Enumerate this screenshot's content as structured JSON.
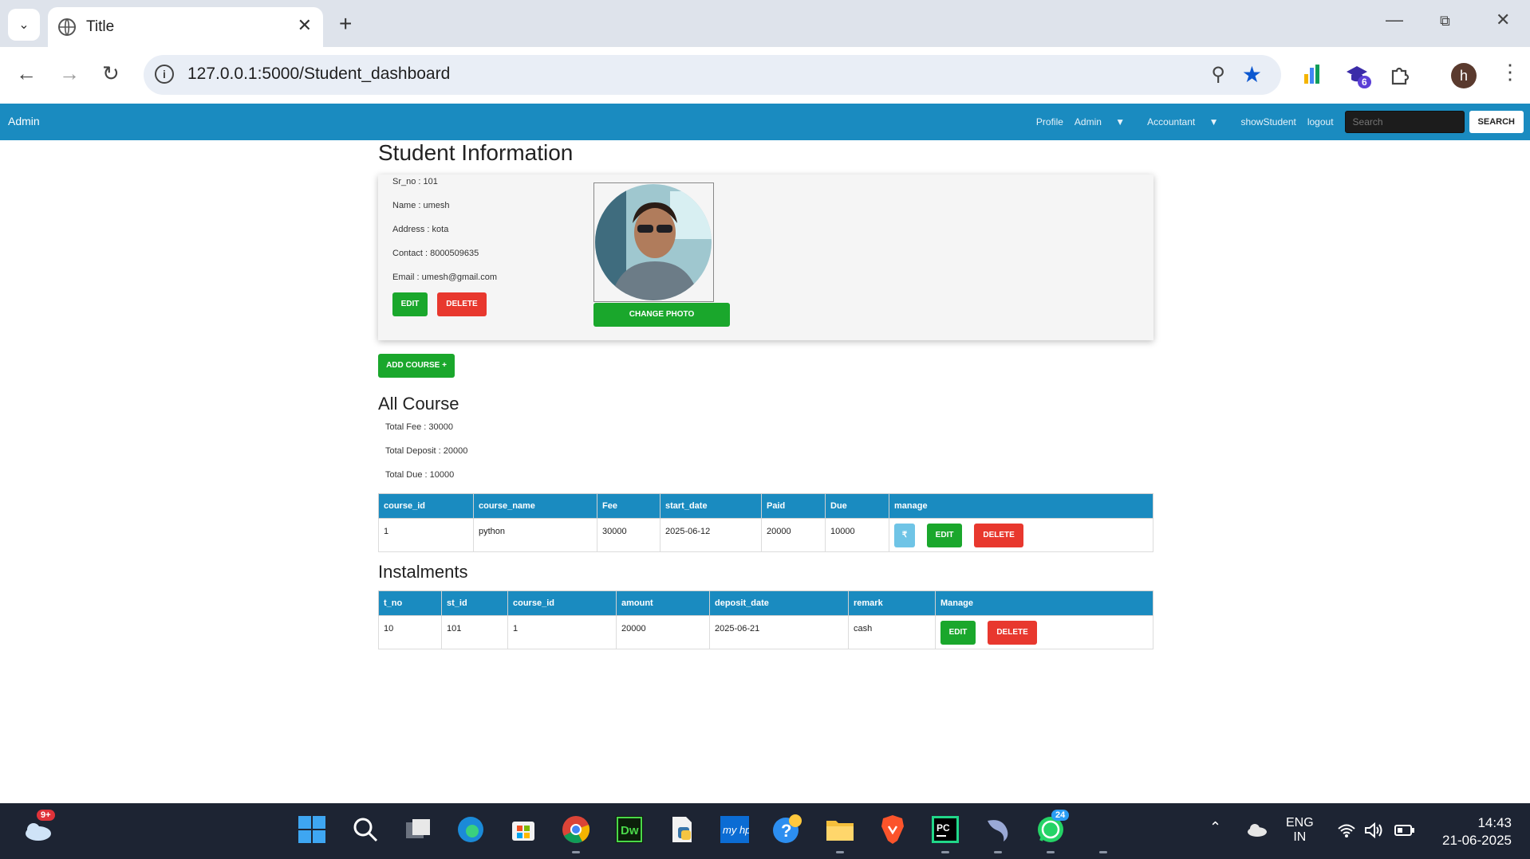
{
  "browser": {
    "tab_title": "Title",
    "url": "127.0.0.1:5000/Student_dashboard",
    "extension_badge": "6",
    "profile_initial": "h"
  },
  "navbar": {
    "brand": "Admin",
    "links": [
      "Profile",
      "Admin",
      "Accountant",
      "showStudent",
      "logout"
    ],
    "search_placeholder": "Search",
    "search_button": "SEARCH"
  },
  "student": {
    "heading": "Student Information",
    "sr_no": "Sr_no : 101",
    "name": "Name : umesh",
    "address": "Address : kota",
    "contact": "Contact : 8000509635",
    "email": "Email : umesh@gmail.com",
    "edit_label": "EDIT",
    "delete_label": "DELETE",
    "change_photo_label": "CHANGE PHOTO",
    "add_course_label": "ADD COURSE +"
  },
  "courses": {
    "heading": "All Course",
    "total_fee": "Total Fee : 30000",
    "total_deposit": "Total Deposit : 20000",
    "total_due": "Total Due : 10000",
    "columns": [
      "course_id",
      "course_name",
      "Fee",
      "start_date",
      "Paid",
      "Due",
      "manage"
    ],
    "rows": [
      {
        "course_id": "1",
        "course_name": "python",
        "fee": "30000",
        "start_date": "2025-06-12",
        "paid": "20000",
        "due": "10000"
      }
    ],
    "rupee_label": "₹",
    "edit_label": "EDIT",
    "delete_label": "DELETE"
  },
  "instalments": {
    "heading": "Instalments",
    "columns": [
      "t_no",
      "st_id",
      "course_id",
      "amount",
      "deposit_date",
      "remark",
      "Manage"
    ],
    "rows": [
      {
        "t_no": "10",
        "st_id": "101",
        "course_id": "1",
        "amount": "20000",
        "deposit_date": "2025-06-21",
        "remark": "cash"
      }
    ],
    "edit_label": "EDIT",
    "delete_label": "DELETE"
  },
  "taskbar": {
    "weather_badge": "9+",
    "whatsapp_badge": "24",
    "lang_line1": "ENG",
    "lang_line2": "IN",
    "time": "14:43",
    "date": "21-06-2025"
  },
  "colors": {
    "navbar": "#1a8bc0",
    "success": "#1aa72c",
    "danger": "#e8382e",
    "info": "#6fc4e6"
  }
}
